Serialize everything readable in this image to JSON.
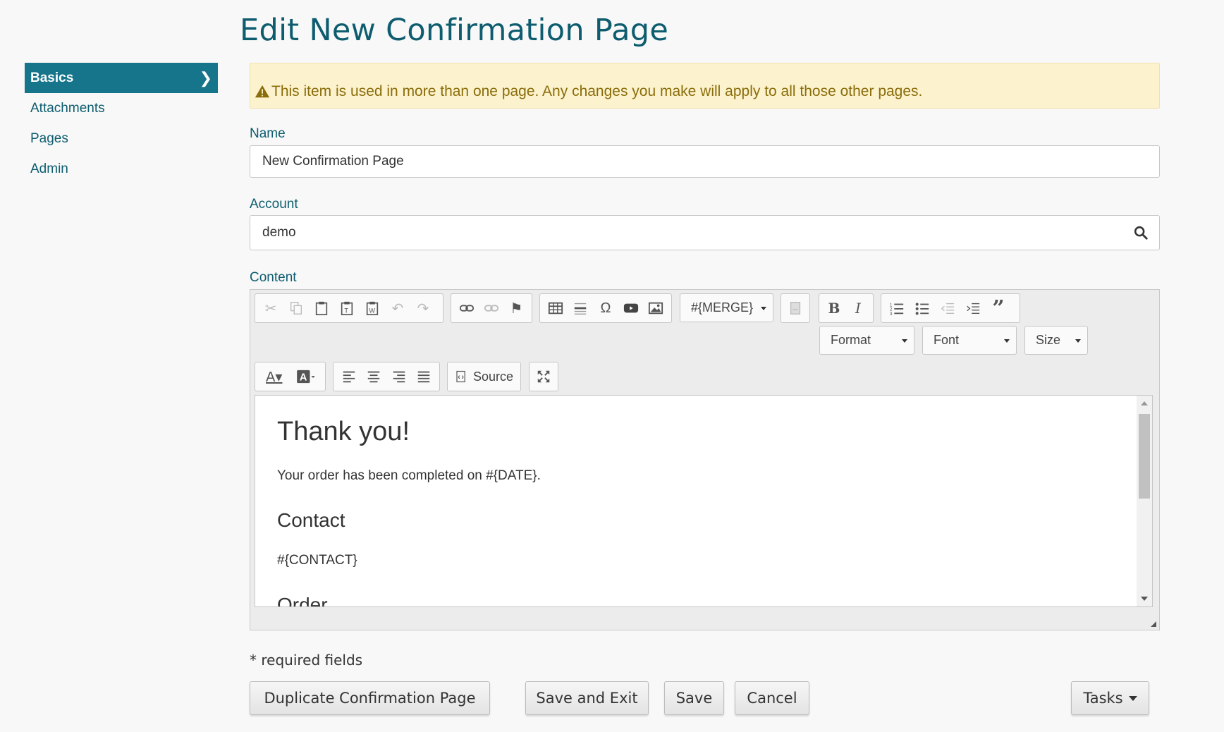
{
  "page": {
    "title": "Edit New Confirmation Page"
  },
  "sidebar": {
    "items": [
      {
        "label": "Basics",
        "active": true
      },
      {
        "label": "Attachments"
      },
      {
        "label": "Pages"
      },
      {
        "label": "Admin"
      }
    ]
  },
  "warning": {
    "text": "This item is used in more than one page. Any changes you make will apply to all those other pages."
  },
  "form": {
    "name_label": "Name",
    "name_value": "New Confirmation Page",
    "account_label": "Account",
    "account_value": "demo",
    "content_label": "Content"
  },
  "editor": {
    "merge_label": "#{MERGE}",
    "format_label": "Format",
    "font_label": "Font",
    "size_label": "Size",
    "source_label": "Source",
    "content": {
      "heading": "Thank you!",
      "paragraph": "Your order has been completed on #{DATE}.",
      "contact_heading": "Contact",
      "contact_merge": "#{CONTACT}",
      "order_heading": "Order"
    }
  },
  "footer": {
    "required_note": "* required fields",
    "duplicate_label": "Duplicate Confirmation Page",
    "save_exit_label": "Save and Exit",
    "save_label": "Save",
    "cancel_label": "Cancel",
    "tasks_label": "Tasks"
  },
  "colors": {
    "accent": "#16748b",
    "title": "#0e5d6f",
    "warning_bg": "#fcf2cd",
    "warning_text": "#8a6d0b"
  }
}
